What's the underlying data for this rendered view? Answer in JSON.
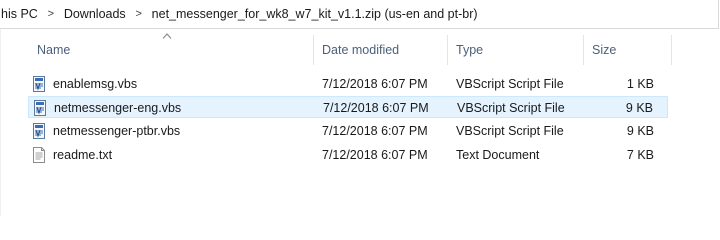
{
  "breadcrumb": {
    "items": [
      "his PC",
      "Downloads",
      "net_messenger_for_wk8_w7_kit_v1.1.zip (us-en and pt-br)"
    ],
    "separator": ">"
  },
  "columns": {
    "name": "Name",
    "date": "Date modified",
    "type": "Type",
    "size": "Size",
    "sorted_by": "name"
  },
  "files": [
    {
      "name": "enablemsg.vbs",
      "date": "7/12/2018 6:07 PM",
      "type": "VBScript Script File",
      "size": "1 KB",
      "icon": "vbscript-file-icon",
      "selected": false
    },
    {
      "name": "netmessenger-eng.vbs",
      "date": "7/12/2018 6:07 PM",
      "type": "VBScript Script File",
      "size": "9 KB",
      "icon": "vbscript-file-icon",
      "selected": true
    },
    {
      "name": "netmessenger-ptbr.vbs",
      "date": "7/12/2018 6:07 PM",
      "type": "VBScript Script File",
      "size": "9 KB",
      "icon": "vbscript-file-icon",
      "selected": false
    },
    {
      "name": "readme.txt",
      "date": "7/12/2018 6:07 PM",
      "type": "Text Document",
      "size": "7 KB",
      "icon": "text-file-icon",
      "selected": false
    }
  ],
  "colors": {
    "selection_bg": "#e5f3ff",
    "selection_border": "#cce8ff",
    "header_text": "#4c607a"
  }
}
